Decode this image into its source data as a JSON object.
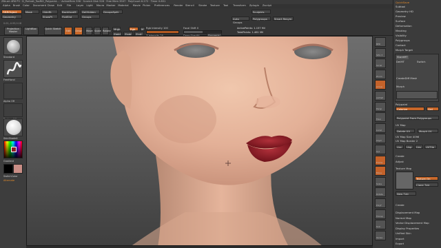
{
  "window": {
    "title": "ZBrush 4R6 P3 · D_Portrait_TooRIG_Polypaint... · ActiveMem 558 · Scratch Disk 528 · Free Mem 3507 · PolyCount 6.272 · Timer 0.851",
    "quicksave": "QuickSave",
    "ui_layout": "DefaultZScript"
  },
  "menubar": [
    "Alpha",
    "Brush",
    "Color",
    "Document",
    "Draw",
    "Edit",
    "File",
    "Layer",
    "Light",
    "Macro",
    "Marker",
    "Material",
    "Movie",
    "Picker",
    "Preferences",
    "Render",
    "Stencil",
    "Stroke",
    "Texture",
    "Tool",
    "Transform",
    "Zplugin",
    "Zscript"
  ],
  "shelf": {
    "top_buttons": [
      "FiBRObject",
      "Geometry",
      "Mask",
      "HideRt",
      "ShowPt",
      "BackfaceM",
      "FlatShd",
      "DelHidden",
      "Groups",
      "GroupsSplit",
      "Auto Groups",
      "Sculptris",
      "Polygroups",
      "Smart Resym"
    ],
    "projection_master": "Projection Master",
    "lightbox": "LightBox",
    "quick_sketch": "Quick Sketch",
    "edit_label": "Edit",
    "draw_label": "Draw",
    "move_label": "Move",
    "scale_label": "Scale",
    "rotate_label": "Rotate",
    "mrgb": "Mrgb",
    "rgb": "Rgb",
    "m": "M",
    "zadd": "Zadd",
    "zsub": "Zsub",
    "zcut": "Zcut",
    "focal_shift_label": "Focal Shift 0",
    "draw_size_label": "Draw Size 64",
    "dynamic": "Dynamic",
    "rgb_intensity_label": "Rgb Intensity 100",
    "z_intensity_label": "Z Intensity 25",
    "active_points": "ActivePoints: 1.157 Mil",
    "total_points": "TotalPoints: 1.461 Mil",
    "coords": "0.01,-0.93,0.18"
  },
  "left_tray": {
    "brush_label": "Standard",
    "stroke_label": "FreeHand",
    "alpha_label": "Alpha Off",
    "texture_label": "Texture Off",
    "material_label": "SkinShade4",
    "gradient_label": "Gradient",
    "switch_color_label": "SwitchColor",
    "alternate_label": "Alternate"
  },
  "right_column": [
    "BPR",
    "SPix 3",
    "Scroll",
    "Zoom",
    "Actual",
    "AAHalf",
    "Persp",
    "Floor",
    "Local",
    "LSym",
    "Xyz",
    "Frame",
    "Move",
    "Scale",
    "Rotate",
    "PolyF",
    "Transp",
    "Solo",
    "Xpose"
  ],
  "palette": {
    "sections": [
      "Subtool",
      "Geometry HD",
      "Preview",
      "Surface",
      "Deformation",
      "Masking",
      "Visibility",
      "Polygroups",
      "Contact",
      "Morph Target",
      "Polypaint",
      "UV Map",
      "Texture Map",
      "Displacement Map",
      "Normal Map",
      "Vector Displacement Map",
      "Display Properties",
      "Unified Skin",
      "Import",
      "Export"
    ],
    "morph": {
      "storemt": "StoreMT",
      "delmt": "DelMT",
      "switch": "Switch",
      "createdifmesh": "CreateDiff Mesh",
      "morph_label": "Morph"
    },
    "polypaint": {
      "colorize": "Colorize",
      "grd": "Grd",
      "from_polygroups": "Polypaint From Polygroups"
    },
    "uvmap": {
      "delete_uv": "Delete UV",
      "morph_uv": "Morph UV",
      "uv_map_size": "UV Map Size 4096",
      "uv_map_border": "UV Map Border 2",
      "uvc": "Uvc",
      "uvp": "Uvp",
      "uvs": "Uvs",
      "uvtile": "UVTile",
      "create": "Create",
      "adjust": "Adjust"
    },
    "texture": {
      "texture_on": "Texture On",
      "clone_txtr": "Clone Txtr",
      "new_txtr": "New Txtr",
      "create": "Create"
    }
  },
  "colors": {
    "accent": "#c9682a",
    "lips": "#8c1c24",
    "skin": "#e7b9a0"
  }
}
